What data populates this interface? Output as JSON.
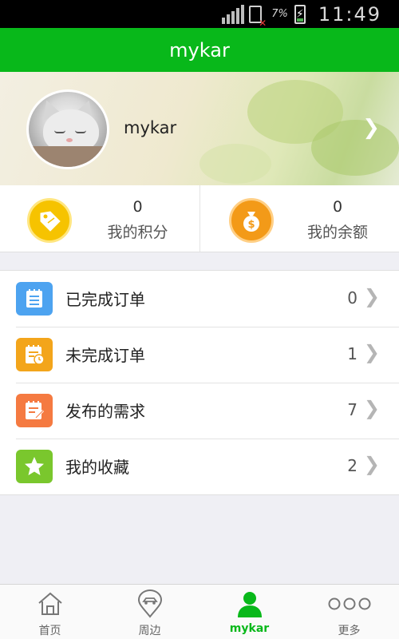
{
  "status_bar": {
    "battery_percent": "7%",
    "time": "11:49"
  },
  "header": {
    "title": "mykar"
  },
  "profile": {
    "username": "mykar",
    "avatar_icon": "cat-photo",
    "arrow_icon": "chevron-right-icon"
  },
  "stats": [
    {
      "value": "0",
      "label": "我的积分",
      "icon": "tag-icon",
      "color": "#f6c300"
    },
    {
      "value": "0",
      "label": "我的余额",
      "icon": "money-bag-icon",
      "color": "#f39a18"
    }
  ],
  "menu": {
    "items": [
      {
        "label": "已完成订单",
        "count": "0",
        "icon": "completed-orders-icon",
        "color": "#4da3f0"
      },
      {
        "label": "未完成订单",
        "count": "1",
        "icon": "pending-orders-icon",
        "color": "#f3a51b"
      },
      {
        "label": "发布的需求",
        "count": "7",
        "icon": "published-requests-icon",
        "color": "#f57a41"
      },
      {
        "label": "我的收藏",
        "count": "2",
        "icon": "star-icon",
        "color": "#7ac72d"
      }
    ]
  },
  "bottom_nav": {
    "items": [
      {
        "label": "首页",
        "icon": "home-icon",
        "active": false
      },
      {
        "label": "周边",
        "icon": "location-pin-icon",
        "active": false
      },
      {
        "label": "mykar",
        "icon": "user-icon",
        "active": true
      },
      {
        "label": "更多",
        "icon": "more-dots-icon",
        "active": false
      }
    ],
    "active_color": "#08b81a"
  },
  "colors": {
    "brand_green": "#08b81a",
    "status_bar": "#000000",
    "page_bg": "#efeff4"
  }
}
